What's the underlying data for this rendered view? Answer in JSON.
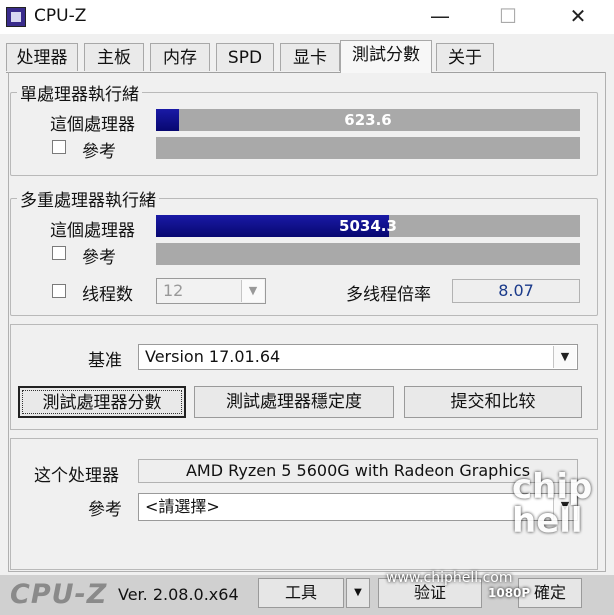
{
  "window": {
    "title": "CPU-Z",
    "minimize": "—",
    "maximize": "☐",
    "close": "✕"
  },
  "tabs": [
    "处理器",
    "主板",
    "内存",
    "SPD",
    "显卡",
    "測試分數",
    "关于"
  ],
  "active_tab": 5,
  "single_thread": {
    "legend": "單處理器執行緒",
    "this_cpu_label": "這個處理器",
    "this_cpu_score": "623.6",
    "this_cpu_fraction": 0.055,
    "reference_label": "參考"
  },
  "multi_thread": {
    "legend": "多重處理器執行緒",
    "this_cpu_label": "這個處理器",
    "this_cpu_score": "5034.3",
    "this_cpu_fraction": 0.55,
    "reference_label": "參考",
    "threads_label": "线程数",
    "threads_value": "12",
    "ratio_label": "多线程倍率",
    "ratio_value": "8.07"
  },
  "benchmark": {
    "label": "基准",
    "version": "Version 17.01.64",
    "btn_bench": "測試處理器分數",
    "btn_stress": "測試處理器穩定度",
    "btn_submit": "提交和比较"
  },
  "processor": {
    "this_label": "这个处理器",
    "this_value": "AMD Ryzen 5 5600G with Radeon Graphics",
    "ref_label": "參考",
    "ref_value": "<請選擇>"
  },
  "footer": {
    "logo": "CPU-Z",
    "version": "Ver. 2.08.0.x64",
    "tools": "工具",
    "validate": "验证",
    "ok": "確定"
  },
  "watermark": {
    "site": "www.chiphell.com",
    "res": "1080P",
    "brand": "chip hell"
  },
  "colors": {
    "bar_fill": "#0a0a8a",
    "bar_bg": "#a9a9a9"
  }
}
